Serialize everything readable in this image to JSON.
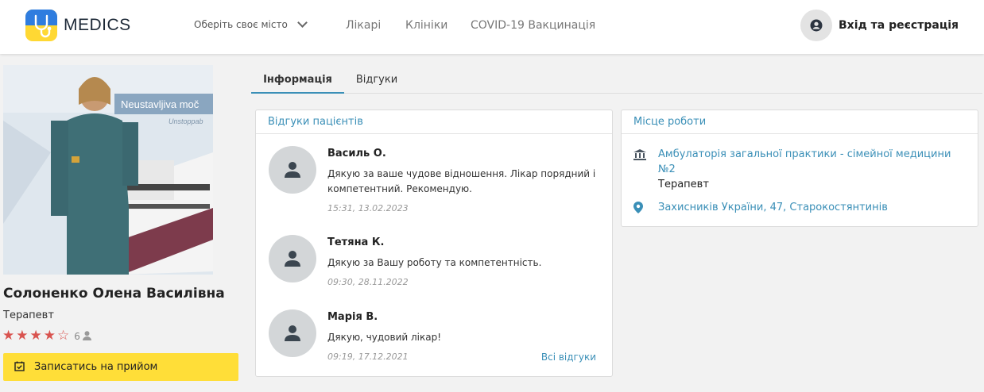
{
  "header": {
    "logo_text": "MEDICS",
    "city_select": "Оберіть своє місто",
    "nav": [
      "Лікарі",
      "Клініки",
      "COVID-19 Вакцинація"
    ],
    "login": "Вхід та реєстрація"
  },
  "doctor": {
    "name": "Солоненко Олена Василівна",
    "specialty": "Терапевт",
    "rating": 4,
    "rating_max": 5,
    "reviews_count": "6",
    "book_button": "Записатись на прийом",
    "photo_banner_text": "Neustavljiva moč",
    "photo_banner_sub": "Unstoppab"
  },
  "tabs": [
    "Інформація",
    "Відгуки"
  ],
  "reviews_card": {
    "title": "Відгуки пацієнтів",
    "reviews": [
      {
        "name": "Василь О.",
        "text": "Дякую за ваше чудове відношення. Лікар порядний і компетентний. Рекомендую.",
        "date": "15:31, 13.02.2023"
      },
      {
        "name": "Тетяна К.",
        "text": "Дякую за Вашу роботу та компетентність.",
        "date": "09:30, 28.11.2022"
      },
      {
        "name": "Марія В.",
        "text": "Дякую, чудовий лікар!",
        "date": "09:19, 17.12.2021"
      }
    ],
    "all_link": "Всі відгуки"
  },
  "work_card": {
    "title": "Місце роботи",
    "clinic": "Амбулаторія загальної практики - сімейної медицини №2",
    "role": "Терапевт",
    "address": "Захисників України, 47, Старокостянтинів"
  },
  "colors": {
    "accent": "#3a8fb7",
    "star": "#d9534f",
    "button": "#ffde38"
  }
}
